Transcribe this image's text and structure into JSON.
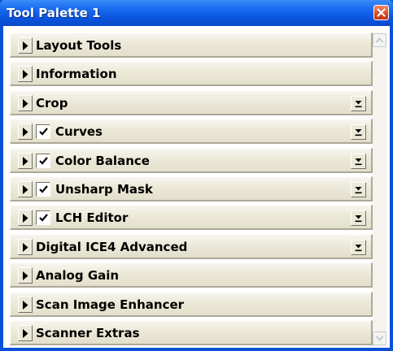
{
  "window": {
    "title": "Tool Palette 1",
    "close_icon": "close-icon"
  },
  "rows": [
    {
      "label": "Layout Tools",
      "checkbox": false,
      "checked": false,
      "menu": false
    },
    {
      "label": "Information",
      "checkbox": false,
      "checked": false,
      "menu": false
    },
    {
      "label": "Crop",
      "checkbox": false,
      "checked": false,
      "menu": true
    },
    {
      "label": "Curves",
      "checkbox": true,
      "checked": true,
      "menu": true
    },
    {
      "label": "Color Balance",
      "checkbox": true,
      "checked": true,
      "menu": true
    },
    {
      "label": "Unsharp Mask",
      "checkbox": true,
      "checked": true,
      "menu": true
    },
    {
      "label": "LCH Editor",
      "checkbox": true,
      "checked": true,
      "menu": true
    },
    {
      "label": "Digital ICE4 Advanced",
      "checkbox": false,
      "checked": false,
      "menu": true
    },
    {
      "label": "Analog Gain",
      "checkbox": false,
      "checked": false,
      "menu": false
    },
    {
      "label": "Scan Image Enhancer",
      "checkbox": false,
      "checked": false,
      "menu": false
    },
    {
      "label": "Scanner Extras",
      "checkbox": false,
      "checked": false,
      "menu": false
    }
  ],
  "colors": {
    "titlebar": "#0b54df",
    "panel": "#ece9d8",
    "close": "#d94621"
  }
}
